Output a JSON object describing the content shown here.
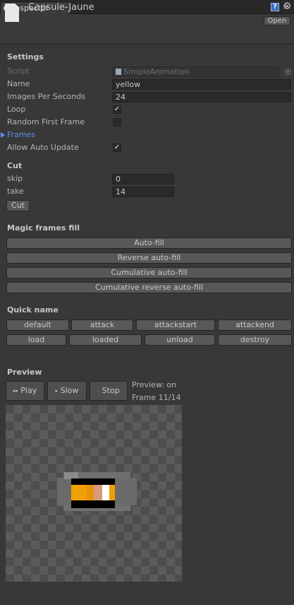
{
  "tab": {
    "label": "Inspector"
  },
  "header": {
    "object_name": "Capsule-Jaune",
    "open_label": "Open"
  },
  "settings": {
    "title": "Settings",
    "script_label": "Script",
    "script_value": "SimpleAnimation",
    "name_label": "Name",
    "name_value": "yellow",
    "ips_label": "Images Per Seconds",
    "ips_value": "24",
    "loop_label": "Loop",
    "loop_checked": true,
    "random_label": "Random First Frame",
    "random_checked": false,
    "frames_label": "Frames",
    "auto_update_label": "Allow Auto Update",
    "auto_update_checked": true
  },
  "cut": {
    "title": "Cut",
    "skip_label": "skip",
    "skip_value": "0",
    "take_label": "take",
    "take_value": "14",
    "cut_button": "Cut"
  },
  "magic": {
    "title": "Magic frames fill",
    "buttons": [
      "Auto-fill",
      "Reverse auto-fill",
      "Cumulative auto-fill",
      "Cumulative reverse auto-fill"
    ]
  },
  "quick_name": {
    "title": "Quick name",
    "row1": [
      "default",
      "attack",
      "attackstart",
      "attackend"
    ],
    "row2": [
      "load",
      "loaded",
      "unload",
      "destroy"
    ]
  },
  "preview": {
    "title": "Preview",
    "play": "Play",
    "slow": "Slow",
    "stop": "Stop",
    "status": "Preview: on",
    "frame": "Frame 11/14"
  },
  "colors": {
    "background": "#383838",
    "accent_blue": "#5c8ef0",
    "capsule_orange": "#f0a000",
    "capsule_light": "#d89a7c",
    "capsule_white": "#ffffff"
  }
}
